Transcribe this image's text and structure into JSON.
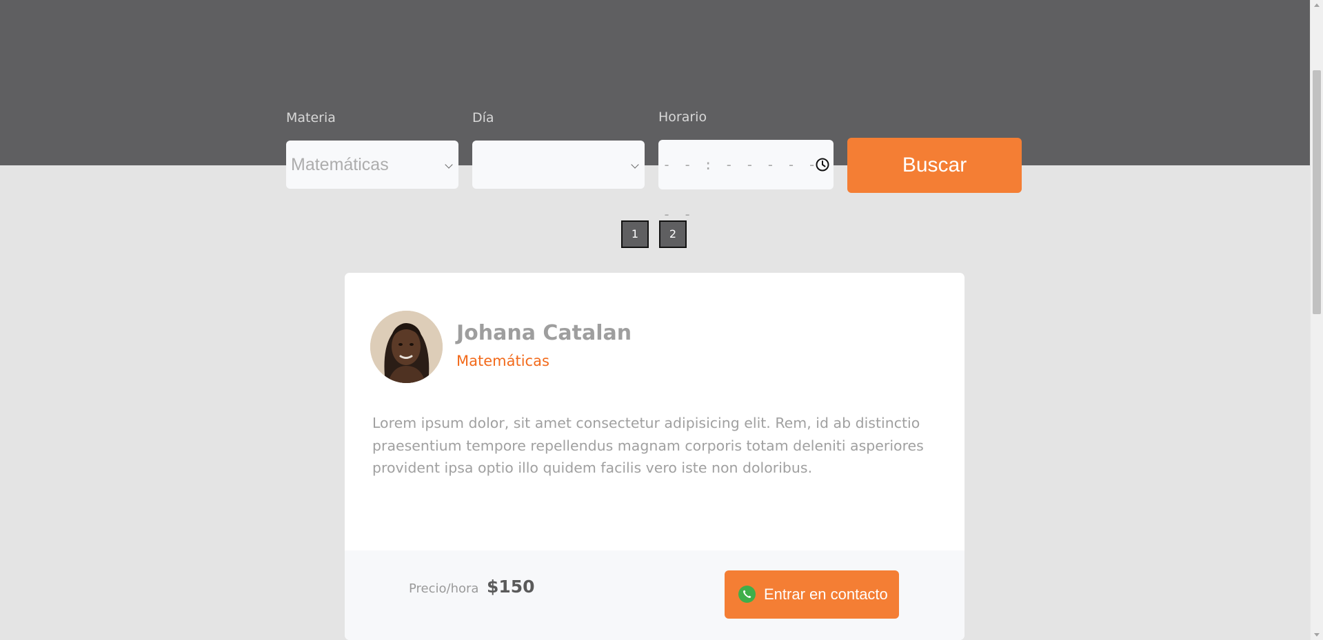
{
  "search": {
    "materia": {
      "label": "Materia",
      "value": "Matemáticas"
    },
    "dia": {
      "label": "Día",
      "value": ""
    },
    "horario": {
      "label": "Horario",
      "value": "- - : - -   - - - - -"
    },
    "button_label": "Buscar"
  },
  "pagination": {
    "pages": [
      "1",
      "2"
    ]
  },
  "tutor": {
    "name": "Johana Catalan",
    "subject": "Matemáticas",
    "description": "Lorem ipsum dolor, sit amet consectetur adipisicing elit. Rem, id ab distinctio praesentium tempore repellendus magnam corporis totam deleniti asperiores provident ipsa optio illo quidem facilis vero iste non doloribus.",
    "price_label": "Precio/hora",
    "price_value": "$150",
    "contact_label": "Entrar en contacto"
  },
  "icons": {
    "clock": "clock-icon",
    "contact": "phone-icon",
    "select_caret": "chevron-down-icon"
  },
  "colors": {
    "header_band": "#5f5f61",
    "background": "#e4e4e4",
    "accent": "#f47e34",
    "subject_text": "#f26a1b",
    "phone_icon": "#3fae4a"
  }
}
